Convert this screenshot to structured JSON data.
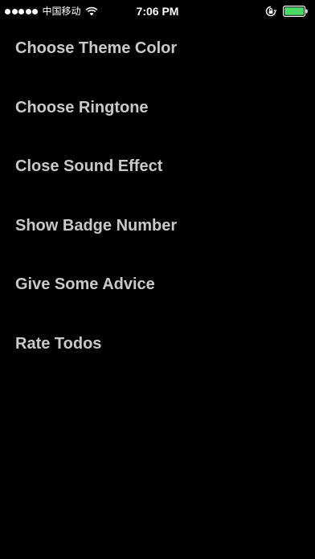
{
  "status_bar": {
    "carrier": "中国移动",
    "time": "7:06 PM",
    "signal_bars": 5,
    "wifi_icon": "wifi-icon",
    "rotation_lock_icon": "rotation-lock-icon",
    "battery_icon": "battery-icon",
    "battery_color": "#4cd964"
  },
  "menu": {
    "items": [
      {
        "label": "Choose Theme Color"
      },
      {
        "label": "Choose Ringtone"
      },
      {
        "label": "Close Sound Effect"
      },
      {
        "label": "Show Badge Number"
      },
      {
        "label": "Give Some Advice"
      },
      {
        "label": "Rate Todos"
      }
    ]
  },
  "colors": {
    "background": "#000000",
    "text": "#c9c9c9",
    "status_text": "#ffffff"
  }
}
